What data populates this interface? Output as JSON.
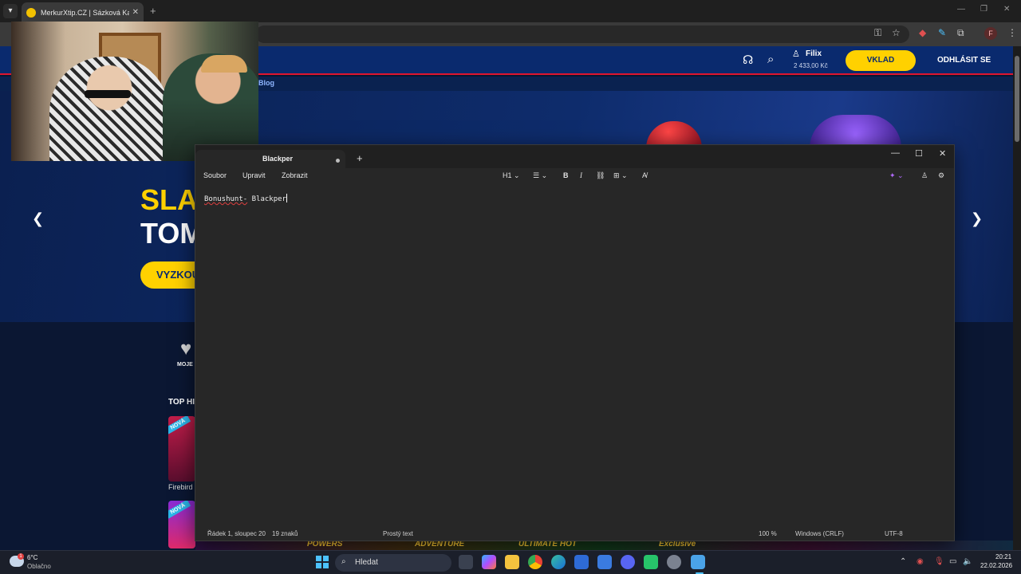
{
  "browser": {
    "tab_title": "MerkurXtip.CZ | Sázková Kancel",
    "tab_close": "✕",
    "new_tab": "+",
    "profile_initial": "F"
  },
  "site": {
    "user_name": "Filix",
    "balance": "2 433,00 Kč",
    "deposit_label": "VKLAD",
    "logout_label": "ODHLÁSIT SE",
    "nav_blog": "Blog",
    "banner_line1": "SLA",
    "banner_line2": "TOM",
    "banner_button": "VYZKOU",
    "favorites_label": "MOJE F",
    "top_section_title": "TOP HI",
    "new_badge": "NOVÁ",
    "game_name": "Firebird",
    "strip_labels": [
      "POWERS",
      "ADVENTURE",
      "ULTIMATE HOT",
      "Exclusive"
    ]
  },
  "notepad": {
    "tab_title": "Blackper",
    "menu": [
      "Soubor",
      "Upravit",
      "Zobrazit"
    ],
    "heading_format": "H1",
    "text_error_part": "Bonushunt-",
    "text_rest": " Blackper",
    "status": {
      "position": "Řádek 1, sloupec 20",
      "chars": "19 znaků",
      "format": "Prostý text",
      "zoom": "100 %",
      "line_endings": "Windows (CRLF)",
      "encoding": "UTF-8"
    }
  },
  "taskbar": {
    "temperature": "6°C",
    "condition": "Oblačno",
    "weather_badge": "1",
    "search_placeholder": "Hledat",
    "time": "20:21",
    "date": "22.02.2026"
  },
  "colors": {
    "site_header": "#0a2a6e",
    "accent_yellow": "#ffd100",
    "accent_red": "#e0152f",
    "notepad_bg": "#272727",
    "taskbar_bg": "#1b1f2a"
  }
}
